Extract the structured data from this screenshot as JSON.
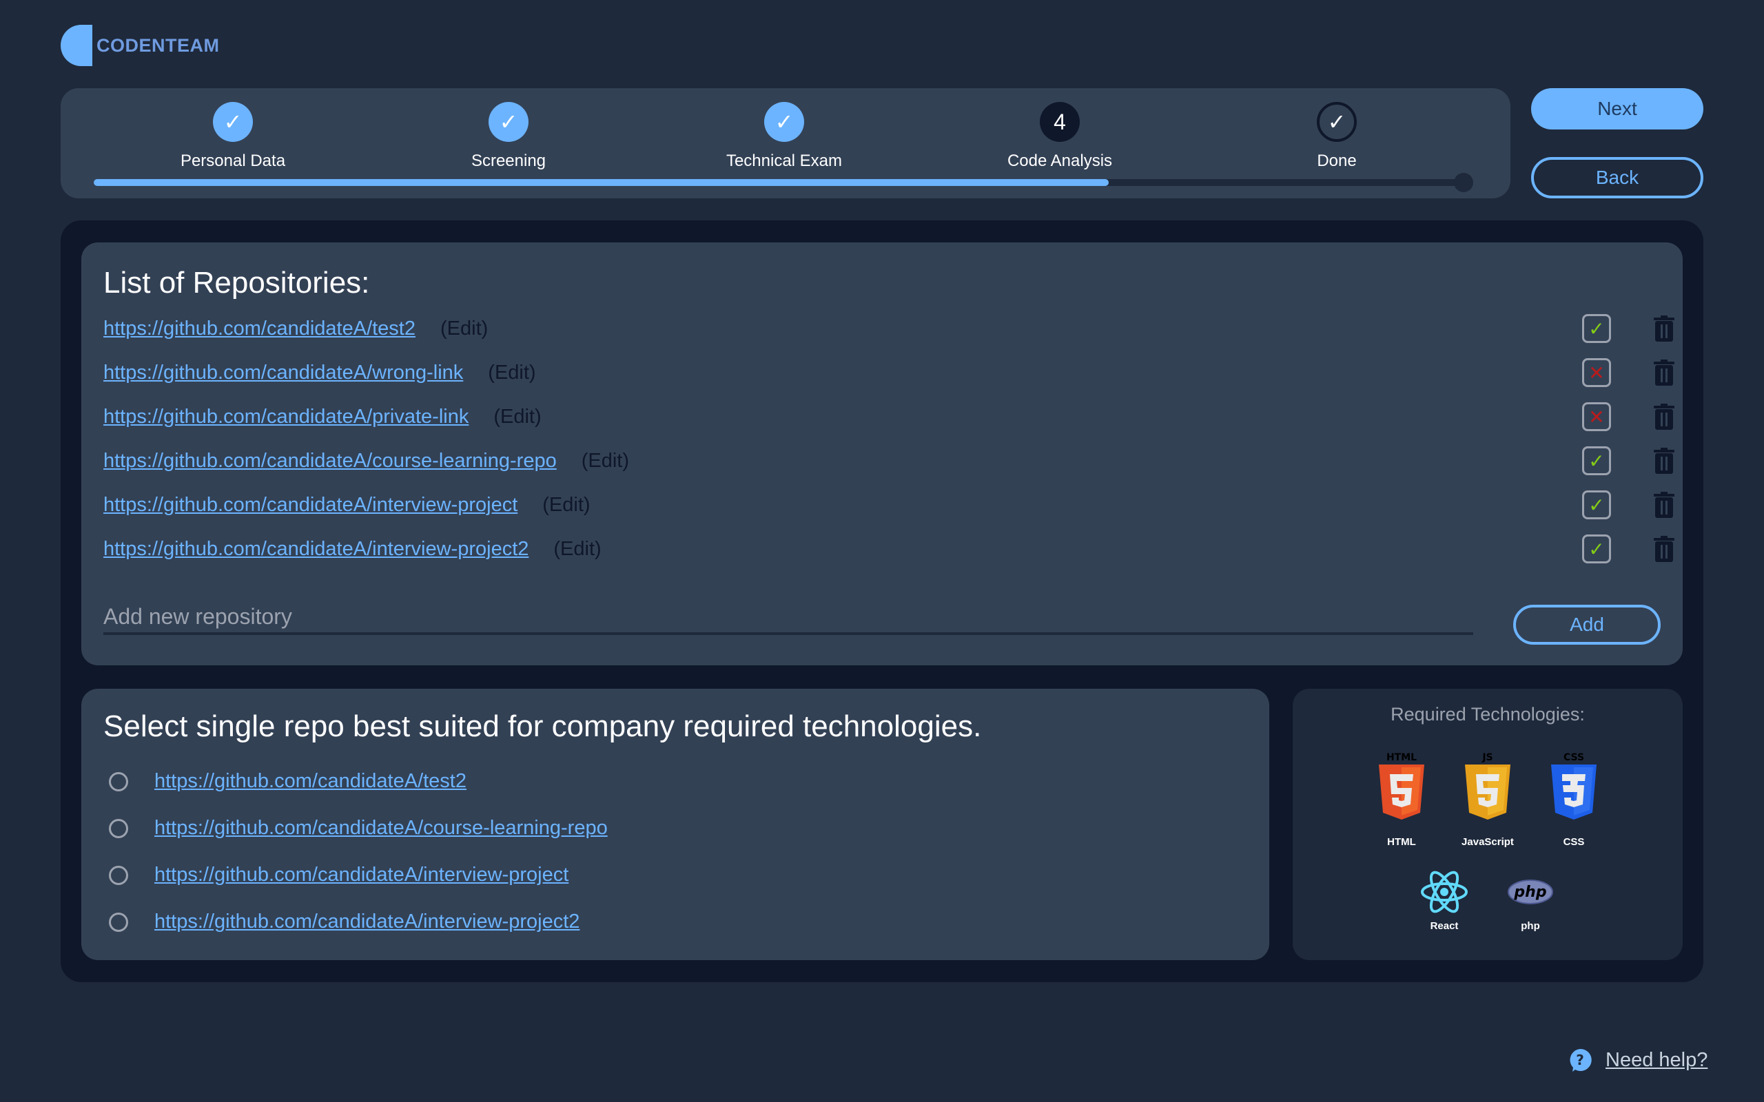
{
  "brand": {
    "name": "CODENTEAM",
    "accent": "#6cb4ff"
  },
  "stepper": {
    "steps": [
      {
        "label": "Personal Data",
        "state": "done",
        "glyph": "✓"
      },
      {
        "label": "Screening",
        "state": "done",
        "glyph": "✓"
      },
      {
        "label": "Technical Exam",
        "state": "done",
        "glyph": "✓"
      },
      {
        "label": "Code Analysis",
        "state": "current",
        "glyph": "4"
      },
      {
        "label": "Done",
        "state": "upcoming",
        "glyph": "✓"
      }
    ],
    "progress_fraction": 0.74
  },
  "nav": {
    "next_label": "Next",
    "back_label": "Back"
  },
  "repositories": {
    "title": "List of Repositories:",
    "edit_label": "(Edit)",
    "items": [
      {
        "url": "https://github.com/candidateA/test2",
        "status": "valid",
        "status_glyph": "✓"
      },
      {
        "url": "https://github.com/candidateA/wrong-link",
        "status": "invalid",
        "status_glyph": "✕"
      },
      {
        "url": "https://github.com/candidateA/private-link",
        "status": "invalid",
        "status_glyph": "✕"
      },
      {
        "url": "https://github.com/candidateA/course-learning-repo",
        "status": "valid",
        "status_glyph": "✓"
      },
      {
        "url": "https://github.com/candidateA/interview-project",
        "status": "valid",
        "status_glyph": "✓"
      },
      {
        "url": "https://github.com/candidateA/interview-project2",
        "status": "valid",
        "status_glyph": "✓"
      }
    ],
    "add_placeholder": "Add new repository",
    "add_value": "",
    "add_label": "Add"
  },
  "selection": {
    "title": "Select single repo best suited for company required technologies.",
    "options": [
      {
        "url": "https://github.com/candidateA/test2",
        "selected": false
      },
      {
        "url": "https://github.com/candidateA/course-learning-repo",
        "selected": false
      },
      {
        "url": "https://github.com/candidateA/interview-project",
        "selected": false
      },
      {
        "url": "https://github.com/candidateA/interview-project2",
        "selected": false
      }
    ]
  },
  "technologies": {
    "title": "Required Technologies:",
    "items": [
      {
        "name": "HTML",
        "icon": "html5-icon",
        "badge": "HTML",
        "color": "#e44d26"
      },
      {
        "name": "JavaScript",
        "icon": "javascript-icon",
        "badge": "JS",
        "color": "#f0a81c"
      },
      {
        "name": "CSS",
        "icon": "css3-icon",
        "badge": "CSS",
        "color": "#1d5fe8"
      },
      {
        "name": "React",
        "icon": "react-icon",
        "color": "#61dafb"
      },
      {
        "name": "php",
        "icon": "php-icon",
        "color": "#7a86b8"
      }
    ]
  },
  "help": {
    "label": "Need help?"
  }
}
